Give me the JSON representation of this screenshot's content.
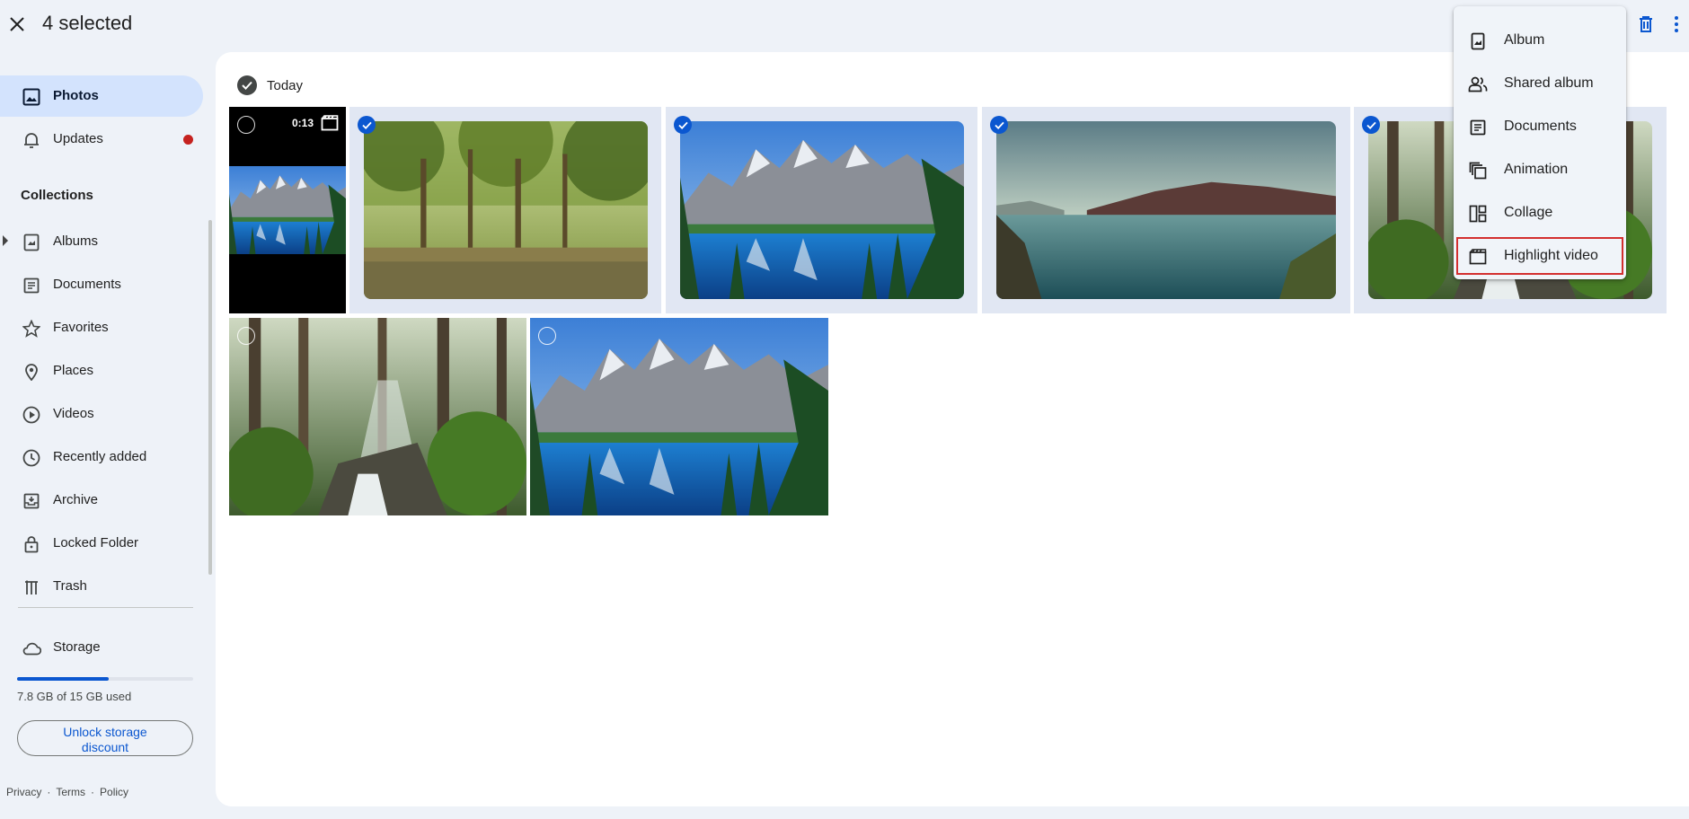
{
  "header": {
    "selection_count": "4 selected",
    "icons": [
      "close-icon",
      "trash-icon",
      "more-vert-icon"
    ]
  },
  "sidebar": {
    "items": [
      {
        "label": "Photos",
        "icon": "photo-icon",
        "active": true
      },
      {
        "label": "Updates",
        "icon": "bell-icon",
        "badge": true
      }
    ],
    "collections_title": "Collections",
    "collections": [
      {
        "label": "Albums",
        "icon": "album-icon"
      },
      {
        "label": "Documents",
        "icon": "document-icon"
      },
      {
        "label": "Favorites",
        "icon": "star-icon"
      },
      {
        "label": "Places",
        "icon": "location-pin-icon"
      },
      {
        "label": "Videos",
        "icon": "play-circle-icon"
      },
      {
        "label": "Recently added",
        "icon": "clock-icon"
      },
      {
        "label": "Archive",
        "icon": "archive-icon"
      },
      {
        "label": "Locked Folder",
        "icon": "lock-icon"
      },
      {
        "label": "Trash",
        "icon": "trash-icon"
      }
    ],
    "storage": {
      "label": "Storage",
      "used_text": "7.8 GB of 15 GB used",
      "used_fraction": 0.52,
      "unlock_line1": "Unlock storage",
      "unlock_line2": "discount"
    },
    "footer": {
      "privacy": "Privacy",
      "sep": "·",
      "terms": "Terms",
      "policy": "Policy"
    }
  },
  "main": {
    "date_label": "Today",
    "video": {
      "duration": "0:13"
    },
    "tiles": [
      {
        "type": "video",
        "selected": false
      },
      {
        "type": "jungle-lagoon",
        "selected": true
      },
      {
        "type": "mountain-lake",
        "selected": true
      },
      {
        "type": "misty-lake",
        "selected": true
      },
      {
        "type": "forest-waterfall",
        "selected": true
      },
      {
        "type": "forest-waterfall",
        "selected": false
      },
      {
        "type": "mountain-lake",
        "selected": false
      }
    ]
  },
  "menu": {
    "items": [
      {
        "label": "Album",
        "icon": "album-icon"
      },
      {
        "label": "Shared album",
        "icon": "people-icon"
      },
      {
        "label": "Documents",
        "icon": "document-icon"
      },
      {
        "label": "Animation",
        "icon": "animation-icon"
      },
      {
        "label": "Collage",
        "icon": "collage-icon"
      },
      {
        "label": "Highlight video",
        "icon": "movie-icon",
        "highlighted": true
      }
    ]
  },
  "colors": {
    "accent": "#0b57d0",
    "active_nav": "#d3e3fd",
    "badge": "#c5221f",
    "highlight_outline": "#d32f2f",
    "background": "#eef2f8"
  }
}
